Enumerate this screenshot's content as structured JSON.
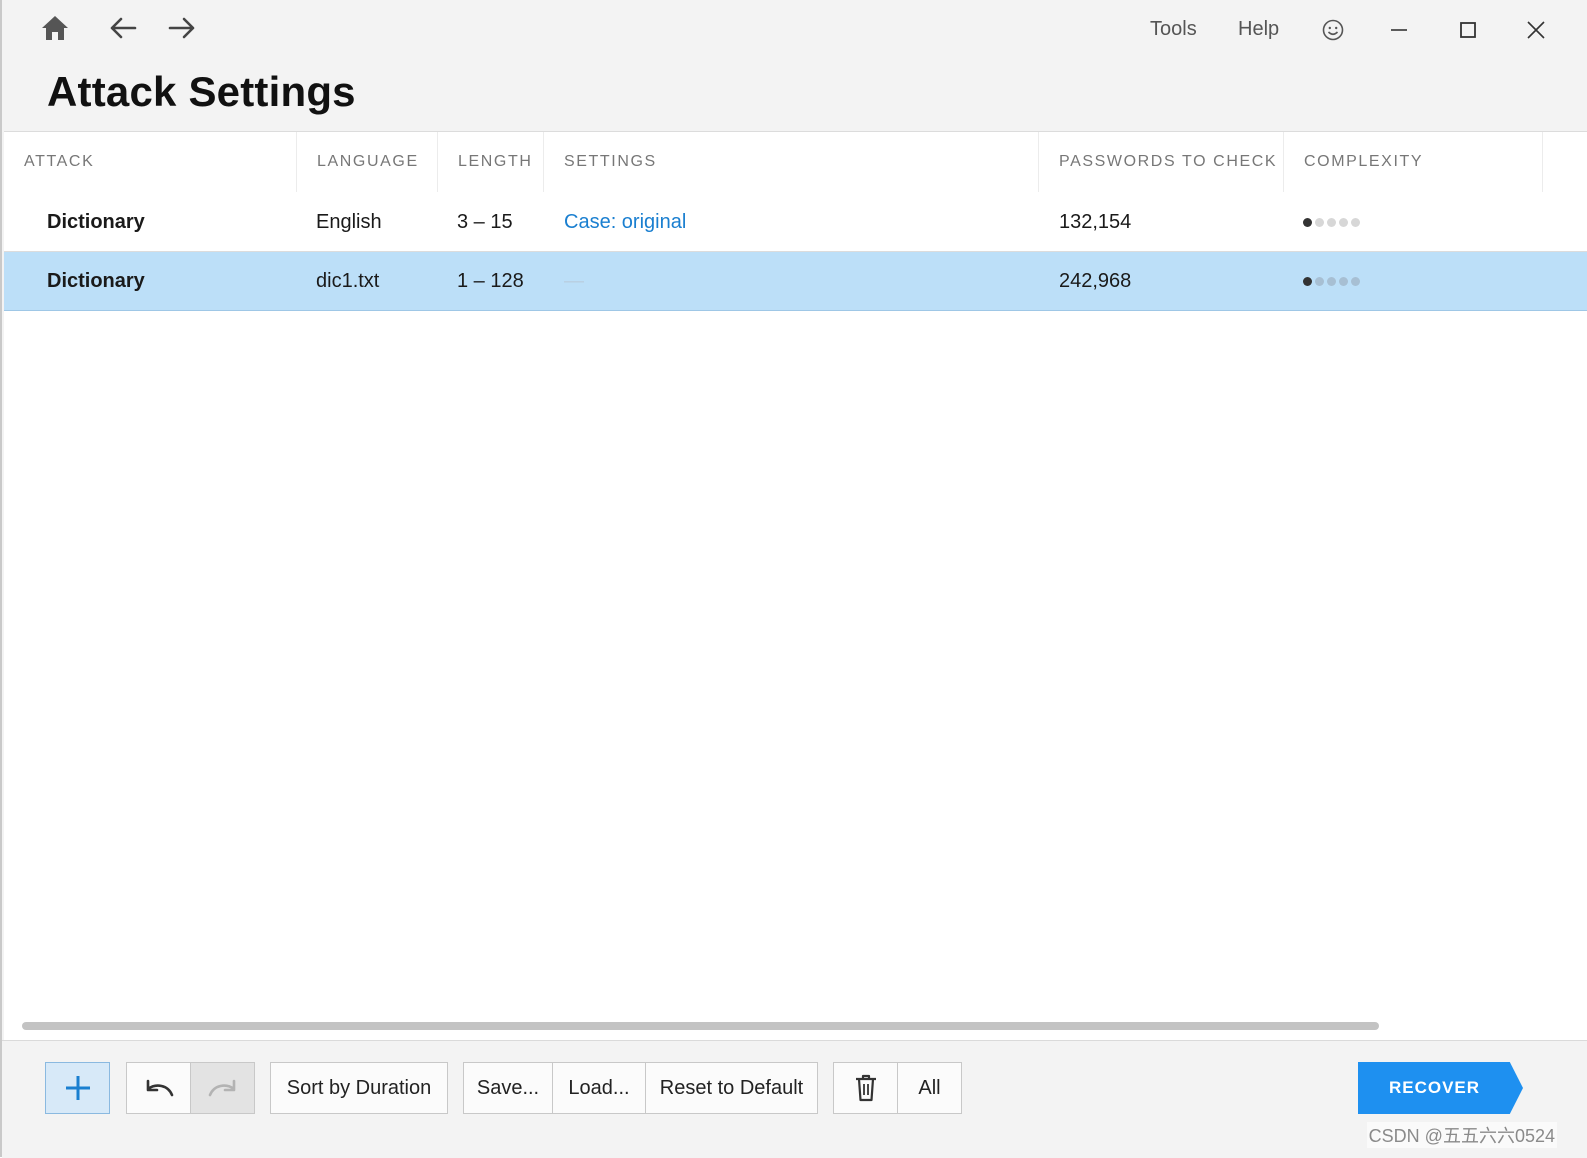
{
  "window": {
    "menu": {
      "tools": "Tools",
      "help": "Help"
    }
  },
  "page": {
    "title": "Attack Settings"
  },
  "table": {
    "columns": [
      "ATTACK",
      "LANGUAGE",
      "LENGTH",
      "SETTINGS",
      "PASSWORDS TO CHECK",
      "COMPLEXITY"
    ],
    "rows": [
      {
        "attack": "Dictionary",
        "language": "English",
        "length": "3 – 15",
        "settings": "Case: original",
        "passwords": "132,154",
        "complexity_level": 1,
        "complexity_max": 5
      },
      {
        "attack": "Dictionary",
        "language": "dic1.txt",
        "length": "1 – 128",
        "settings": "—",
        "passwords": "242,968",
        "complexity_level": 1,
        "complexity_max": 5,
        "selected": true
      }
    ]
  },
  "toolbar": {
    "sort_label": "Sort by Duration",
    "save_label": "Save...",
    "load_label": "Load...",
    "reset_label": "Reset to Default",
    "all_label": "All",
    "recover_label": "RECOVER"
  },
  "icons": {
    "home": "home-icon",
    "back": "arrow-left-icon",
    "forward": "arrow-right-icon",
    "feedback": "smiley-icon",
    "minimize": "minimize-icon",
    "maximize": "maximize-icon",
    "close": "close-icon",
    "add": "plus-icon",
    "undo": "undo-icon",
    "redo": "redo-icon",
    "delete": "trash-icon"
  },
  "colors": {
    "accent": "#1e90f0",
    "selection": "#bcdff8",
    "link": "#1a7fd0"
  },
  "watermark": "CSDN @五五六六0524"
}
